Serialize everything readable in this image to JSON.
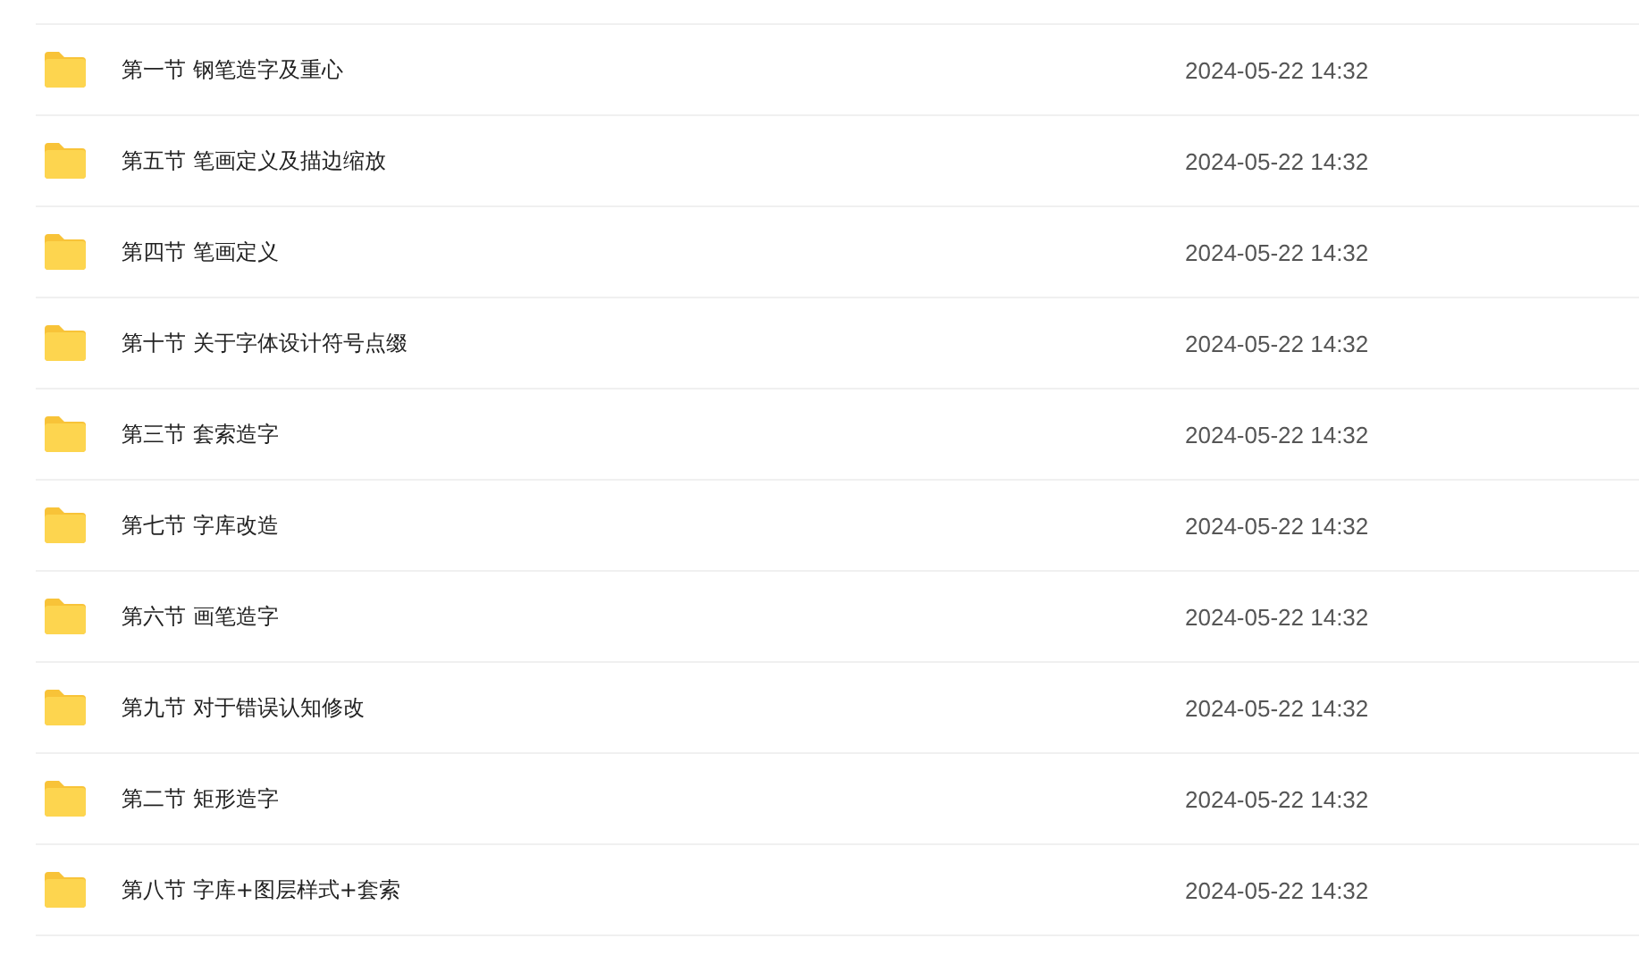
{
  "files": [
    {
      "name": "第一节 钢笔造字及重心",
      "modified": "2024-05-22 14:32"
    },
    {
      "name": "第五节 笔画定义及描边缩放",
      "modified": "2024-05-22 14:32"
    },
    {
      "name": "第四节 笔画定义",
      "modified": "2024-05-22 14:32"
    },
    {
      "name": "第十节 关于字体设计符号点缀",
      "modified": "2024-05-22 14:32"
    },
    {
      "name": "第三节 套索造字",
      "modified": "2024-05-22 14:32"
    },
    {
      "name": "第七节 字库改造",
      "modified": "2024-05-22 14:32"
    },
    {
      "name": "第六节 画笔造字",
      "modified": "2024-05-22 14:32"
    },
    {
      "name": "第九节 对于错误认知修改",
      "modified": "2024-05-22 14:32"
    },
    {
      "name": "第二节 矩形造字",
      "modified": "2024-05-22 14:32"
    },
    {
      "name": "第八节 字库+图层样式+套索",
      "modified": "2024-05-22 14:32"
    }
  ]
}
